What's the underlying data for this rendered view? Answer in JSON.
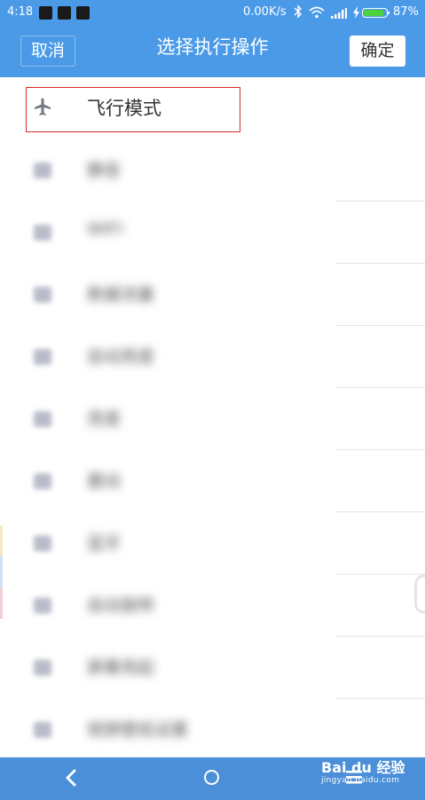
{
  "status_bar": {
    "time": "4:18",
    "net_speed": "0.00K/s",
    "battery_percent": "87%",
    "battery_level": 0.87,
    "notification_icons": [
      "app-icon-1",
      "app-icon-2",
      "app-icon-3"
    ]
  },
  "header": {
    "cancel_label": "取消",
    "title": "选择执行操作",
    "confirm_label": "确定",
    "accent_color": "#4a9ae8"
  },
  "actions": [
    {
      "label": "飞行模式",
      "icon": "airplane-icon",
      "highlighted": true
    },
    {
      "label": "静音",
      "icon": "blurred-icon"
    },
    {
      "label": "WIFI",
      "icon": "blurred-icon"
    },
    {
      "label": "数据流量",
      "icon": "blurred-icon"
    },
    {
      "label": "自动亮度",
      "icon": "blurred-icon"
    },
    {
      "label": "亮度",
      "icon": "blurred-icon"
    },
    {
      "label": "震动",
      "icon": "blurred-icon"
    },
    {
      "label": "蓝牙",
      "icon": "blurred-icon"
    },
    {
      "label": "自动旋转",
      "icon": "blurred-icon"
    },
    {
      "label": "屏幕亮起",
      "icon": "blurred-icon"
    },
    {
      "label": "锁屏壁纸设置",
      "icon": "blurred-icon"
    }
  ],
  "watermark": {
    "brand": "Bai du 经验",
    "url": "jingyan.baidu.com"
  }
}
